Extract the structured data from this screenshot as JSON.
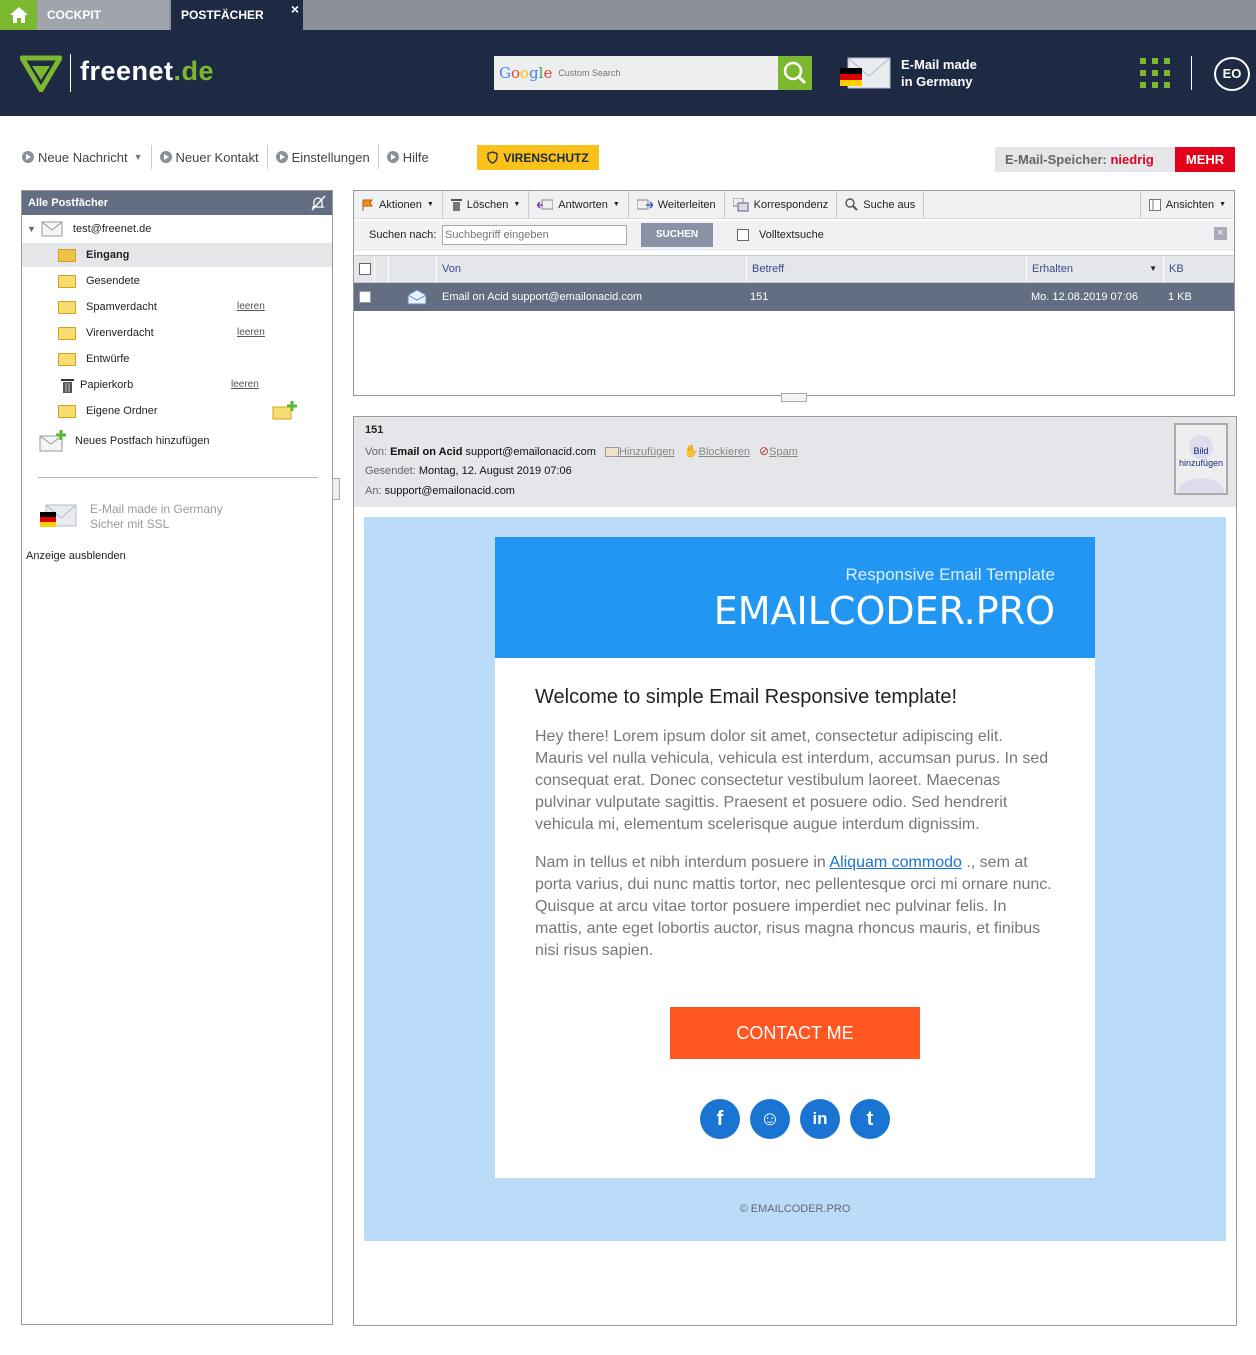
{
  "tabs": {
    "cockpit": "COCKPIT",
    "postfaecher": "POSTFÄCHER",
    "close": "×"
  },
  "header": {
    "logo_main": "freenet",
    "logo_suffix": ".de",
    "search_brand": "Google",
    "search_placeholder": "Custom Search",
    "made_line1": "E-Mail made",
    "made_line2": "in Germany",
    "avatar_initials": "EO"
  },
  "toolbar": {
    "new_message": "Neue Nachricht",
    "new_contact": "Neuer Kontakt",
    "settings": "Einstellungen",
    "help": "Hilfe",
    "virus": "VIRENSCHUTZ",
    "storage_label": "E-Mail-Speicher:",
    "storage_value": "niedrig",
    "more": "MEHR"
  },
  "sidebar": {
    "title": "Alle Postfächer",
    "account": "test@freenet.de",
    "folders": [
      {
        "label": "Eingang"
      },
      {
        "label": "Gesendete"
      },
      {
        "label": "Spamverdacht",
        "action": "leeren"
      },
      {
        "label": "Virenverdacht",
        "action": "leeren"
      },
      {
        "label": "Entwürfe"
      },
      {
        "label": "Papierkorb",
        "action": "leeren"
      },
      {
        "label": "Eigene Ordner"
      }
    ],
    "add_mailbox": "Neues Postfach hinzufügen",
    "ad_line1": "E-Mail made in Germany",
    "ad_line2": "Sicher mit SSL",
    "ad_hide": "Anzeige ausblenden"
  },
  "list": {
    "actions": [
      "Aktionen",
      "Löschen",
      "Antworten",
      "Weiterleiten",
      "Korrespondenz",
      "Suche aus",
      "Ansichten"
    ],
    "search_label": "Suchen nach:",
    "search_placeholder": "Suchbegriff eingeben",
    "search_button": "SUCHEN",
    "fulltext": "Volltextsuche",
    "columns": {
      "from": "Von",
      "subject": "Betreff",
      "received": "Erhalten",
      "size": "KB"
    },
    "rows": [
      {
        "from": "Email on Acid support@emailonacid.com",
        "subject": "151",
        "received": "Mo. 12.08.2019 07:06",
        "size": "1 KB"
      }
    ]
  },
  "preview": {
    "subject": "151",
    "from_label": "Von:",
    "from_name": "Email on Acid",
    "from_addr": "support@emailonacid.com",
    "add": "Hinzufügen",
    "block": "Blockieren",
    "spam": "Spam",
    "sent_label": "Gesendet:",
    "sent_value": "Montag, 12. August 2019 07:06",
    "to_label": "An:",
    "to_value": "support@emailonacid.com",
    "image_line1": "Bild",
    "image_line2": "hinzufügen"
  },
  "email": {
    "subtitle": "Responsive Email Template",
    "title": "EMAILCODER.PRO",
    "welcome": "Welcome to simple Email Responsive template!",
    "para1": "Hey there! Lorem ipsum dolor sit amet, consectetur adipiscing elit. Mauris vel nulla vehicula, vehicula est interdum, accumsan purus. In sed consequat erat. Donec consectetur vestibulum laoreet. Maecenas pulvinar vulputate sagittis. Praesent et posuere odio. Sed hendrerit vehicula mi, elementum scelerisque augue interdum dignissim.",
    "para2_before": "Nam in tellus et nibh interdum posuere in ",
    "para2_link": "Aliquam commodo",
    "para2_after": " ., sem at porta varius, dui nunc mattis tortor, nec pellentesque orci mi ornare nunc. Quisque at arcu vitae tortor posuere imperdiet nec pulvinar felis. In mattis, ante eget lobortis auctor, risus magna rhoncus mauris, et finibus nisi risus sapien.",
    "button": "CONTACT ME",
    "social": [
      "f",
      "☺",
      "in",
      "t"
    ],
    "copyright": "© EMAILCODER.PRO"
  },
  "colors": {
    "brand_green": "#7cb82f",
    "header_bg": "#1e2a44",
    "accent_red": "#e2001a",
    "email_blue": "#2196f3",
    "button_orange": "#ff5722"
  }
}
